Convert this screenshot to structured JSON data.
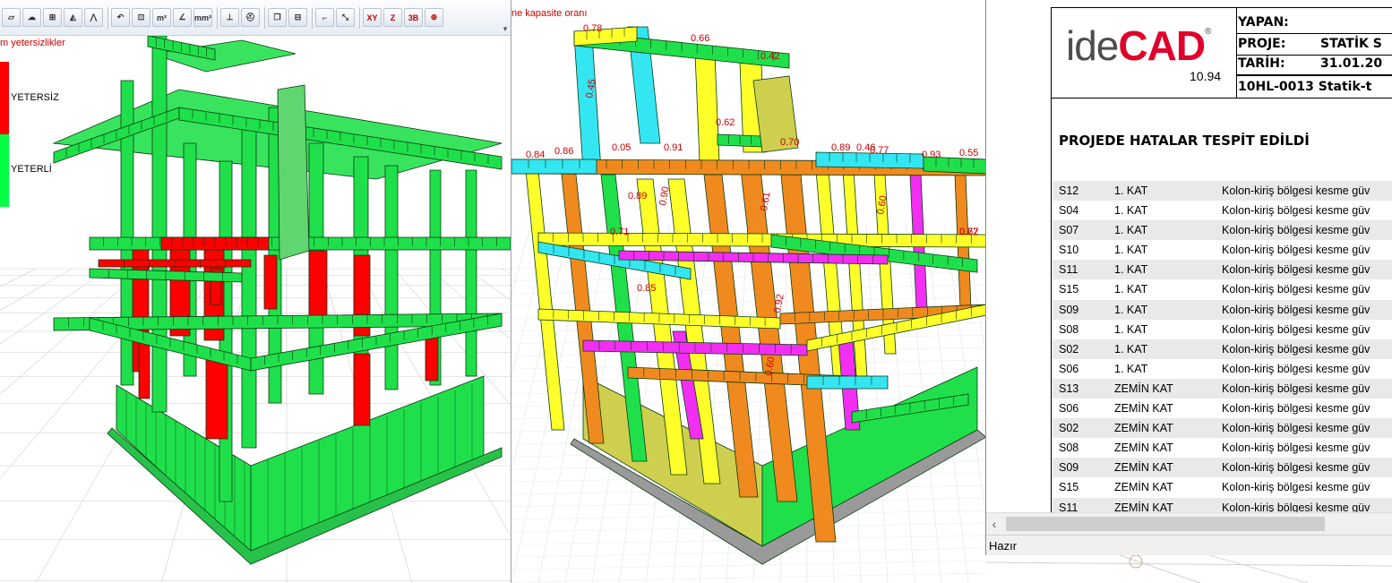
{
  "left_panel": {
    "title": "m yetersizlikler",
    "legend": {
      "bad_label": "YETERSİZ",
      "ok_label": "YETERLİ",
      "bad_color": "#ff0000",
      "ok_color": "#00ff40"
    }
  },
  "toolbar": {
    "buttons": [
      {
        "name": "polygon-select-icon",
        "glyph": "▱"
      },
      {
        "name": "cloud-select-icon",
        "glyph": "☁"
      },
      {
        "name": "grid-select-icon",
        "glyph": "⊞"
      },
      {
        "name": "triangle-icon",
        "glyph": "◭"
      },
      {
        "name": "zigzag-icon",
        "glyph": "⋀"
      },
      {
        "name": "rotate-measure-icon",
        "glyph": "↶"
      },
      {
        "name": "ruler-icon",
        "glyph": "⊡"
      },
      {
        "name": "area-m2-icon",
        "glyph": "m²"
      },
      {
        "name": "angle-icon",
        "glyph": "∠"
      },
      {
        "name": "area-mm2-icon",
        "glyph": "mm²"
      },
      {
        "name": "elevation-icon",
        "glyph": "⊥"
      },
      {
        "name": "helmet-icon",
        "glyph": "⛑"
      },
      {
        "name": "window-icon",
        "glyph": "❐"
      },
      {
        "name": "tile-windows-icon",
        "glyph": "⊟"
      },
      {
        "name": "ucs-axis-icon",
        "glyph": "⌐"
      },
      {
        "name": "dimension-icon",
        "glyph": "⤡"
      },
      {
        "name": "view-xy-icon",
        "glyph": "XY"
      },
      {
        "name": "view-z-icon",
        "glyph": "Z"
      },
      {
        "name": "view-3d-icon",
        "glyph": "3B"
      },
      {
        "name": "zoom-extents-icon",
        "glyph": "⊕"
      }
    ]
  },
  "middle_panel": {
    "title": "ne kapasite oranı",
    "labels": [
      "0.78",
      "0.66",
      "0.42",
      "0.45",
      "0.62",
      "0.05",
      "0.91",
      "0.70",
      "0.89",
      "0.46",
      "0.77",
      "0.93",
      "0.55",
      "0.84",
      "0.86",
      "0.89",
      "0.61",
      "0.92",
      "0.60",
      "0.90",
      "0.71",
      "0.85",
      "0.60",
      "0.62",
      "0.77"
    ]
  },
  "document": {
    "logo": {
      "ide": "ide",
      "cad": "CAD",
      "reg": "®",
      "version": "10.94"
    },
    "header": {
      "yapan_label": "YAPAN:",
      "proje_label": "PROJE:",
      "proje_value": "STATİK S",
      "tarih_label": "TARİH:",
      "tarih_value": "31.01.20",
      "file_name": "10HL-0013 Statik-t"
    },
    "heading": "PROJEDE HATALAR TESPİT EDİLDİ",
    "rows": [
      {
        "id": "S12",
        "floor": "1. KAT",
        "desc": "Kolon-kiriş bölgesi kesme güv"
      },
      {
        "id": "S04",
        "floor": "1. KAT",
        "desc": "Kolon-kiriş bölgesi kesme güv"
      },
      {
        "id": "S07",
        "floor": "1. KAT",
        "desc": "Kolon-kiriş bölgesi kesme güv"
      },
      {
        "id": "S10",
        "floor": "1. KAT",
        "desc": "Kolon-kiriş bölgesi kesme güv"
      },
      {
        "id": "S11",
        "floor": "1. KAT",
        "desc": "Kolon-kiriş bölgesi kesme güv"
      },
      {
        "id": "S15",
        "floor": "1. KAT",
        "desc": "Kolon-kiriş bölgesi kesme güv"
      },
      {
        "id": "S09",
        "floor": "1. KAT",
        "desc": "Kolon-kiriş bölgesi kesme güv"
      },
      {
        "id": "S08",
        "floor": "1. KAT",
        "desc": "Kolon-kiriş bölgesi kesme güv"
      },
      {
        "id": "S02",
        "floor": "1. KAT",
        "desc": "Kolon-kiriş bölgesi kesme güv"
      },
      {
        "id": "S06",
        "floor": "1. KAT",
        "desc": "Kolon-kiriş bölgesi kesme güv"
      },
      {
        "id": "S13",
        "floor": "ZEMİN KAT",
        "desc": "Kolon-kiriş bölgesi kesme güv"
      },
      {
        "id": "S06",
        "floor": "ZEMİN KAT",
        "desc": "Kolon-kiriş bölgesi kesme güv"
      },
      {
        "id": "S02",
        "floor": "ZEMİN KAT",
        "desc": "Kolon-kiriş bölgesi kesme güv"
      },
      {
        "id": "S08",
        "floor": "ZEMİN KAT",
        "desc": "Kolon-kiriş bölgesi kesme güv"
      },
      {
        "id": "S09",
        "floor": "ZEMİN KAT",
        "desc": "Kolon-kiriş bölgesi kesme güv"
      },
      {
        "id": "S15",
        "floor": "ZEMİN KAT",
        "desc": "Kolon-kiriş bölgesi kesme güv"
      },
      {
        "id": "S11",
        "floor": "ZEMİN KAT",
        "desc": "Kolon-kiriş bölgesi kesme güv"
      }
    ]
  },
  "status": {
    "text": "Hazır"
  },
  "colors": {
    "green": "#1fe04a",
    "red": "#ff0000",
    "cyan": "#33e6f2",
    "yellow": "#ffff2a",
    "orange": "#f08a1e",
    "magenta": "#f22ef2",
    "olive": "#cfcf4f",
    "label_red": "#cc0000"
  }
}
